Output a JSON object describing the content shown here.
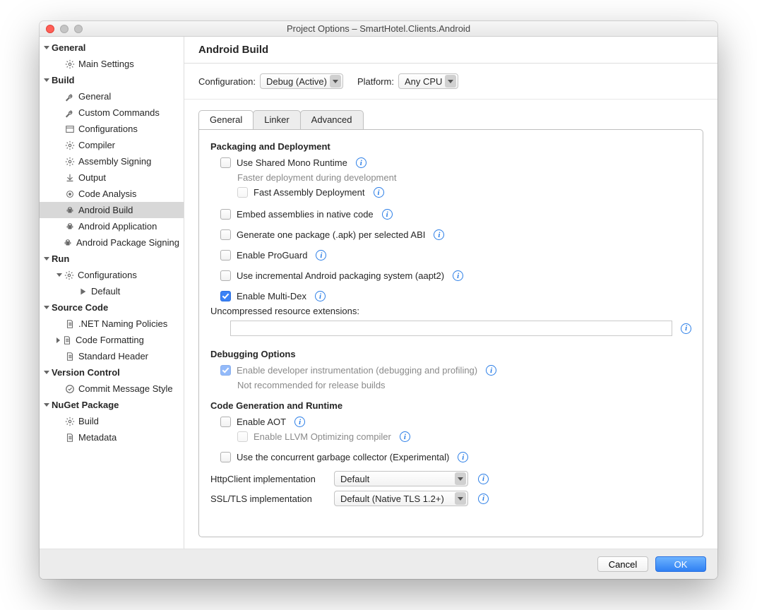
{
  "window_title": "Project Options – SmartHotel.Clients.Android",
  "sidebar": [
    {
      "d": 0,
      "arr": "down",
      "bold": true,
      "label": "General",
      "icon": ""
    },
    {
      "d": 1,
      "arr": "",
      "label": "Main Settings",
      "icon": "gear"
    },
    {
      "d": 0,
      "arr": "down",
      "bold": true,
      "label": "Build",
      "icon": ""
    },
    {
      "d": 1,
      "arr": "",
      "label": "General",
      "icon": "wrench"
    },
    {
      "d": 1,
      "arr": "",
      "label": "Custom Commands",
      "icon": "wrench"
    },
    {
      "d": 1,
      "arr": "",
      "label": "Configurations",
      "icon": "config"
    },
    {
      "d": 1,
      "arr": "",
      "label": "Compiler",
      "icon": "gear"
    },
    {
      "d": 1,
      "arr": "",
      "label": "Assembly Signing",
      "icon": "gear"
    },
    {
      "d": 1,
      "arr": "",
      "label": "Output",
      "icon": "output"
    },
    {
      "d": 1,
      "arr": "",
      "label": "Code Analysis",
      "icon": "target"
    },
    {
      "d": 1,
      "arr": "",
      "label": "Android Build",
      "icon": "android",
      "sel": true
    },
    {
      "d": 1,
      "arr": "",
      "label": "Android Application",
      "icon": "android"
    },
    {
      "d": 1,
      "arr": "",
      "label": "Android Package Signing",
      "icon": "android"
    },
    {
      "d": 0,
      "arr": "down",
      "bold": true,
      "label": "Run",
      "icon": ""
    },
    {
      "d": 1,
      "arr": "down",
      "label": "Configurations",
      "icon": "gear"
    },
    {
      "d": 2,
      "arr": "",
      "label": "Default",
      "icon": "play"
    },
    {
      "d": 0,
      "arr": "down",
      "bold": true,
      "label": "Source Code",
      "icon": ""
    },
    {
      "d": 1,
      "arr": "",
      "label": ".NET Naming Policies",
      "icon": "doc"
    },
    {
      "d": 1,
      "arr": "right",
      "label": "Code Formatting",
      "icon": "doc"
    },
    {
      "d": 1,
      "arr": "",
      "label": "Standard Header",
      "icon": "doc"
    },
    {
      "d": 0,
      "arr": "down",
      "bold": true,
      "label": "Version Control",
      "icon": ""
    },
    {
      "d": 1,
      "arr": "",
      "label": "Commit Message Style",
      "icon": "check"
    },
    {
      "d": 0,
      "arr": "down",
      "bold": true,
      "label": "NuGet Package",
      "icon": ""
    },
    {
      "d": 1,
      "arr": "",
      "label": "Build",
      "icon": "gear"
    },
    {
      "d": 1,
      "arr": "",
      "label": "Metadata",
      "icon": "doc"
    }
  ],
  "page_title": "Android Build",
  "config": {
    "config_label": "Configuration:",
    "config_value": "Debug (Active)",
    "platform_label": "Platform:",
    "platform_value": "Any CPU"
  },
  "tabs": [
    "General",
    "Linker",
    "Advanced"
  ],
  "active_tab": 0,
  "sections": {
    "pkg_title": "Packaging and Deployment",
    "use_shared": "Use Shared Mono Runtime",
    "use_shared_hint": "Faster deployment during development",
    "fast_asm": "Fast Assembly Deployment",
    "embed": "Embed assemblies in native code",
    "per_abi": "Generate one package (.apk) per selected ABI",
    "proguard": "Enable ProGuard",
    "aapt2": "Use incremental Android packaging system (aapt2)",
    "multidex": "Enable Multi-Dex",
    "uncompressed_label": "Uncompressed resource extensions:",
    "uncompressed_value": "",
    "dbg_title": "Debugging Options",
    "devinst": "Enable developer instrumentation (debugging and profiling)",
    "devinst_hint": "Not recommended for release builds",
    "gen_title": "Code Generation and Runtime",
    "aot": "Enable AOT",
    "llvm": "Enable LLVM Optimizing compiler",
    "gc": "Use the concurrent garbage collector (Experimental)",
    "http_label": "HttpClient implementation",
    "http_value": "Default",
    "ssl_label": "SSL/TLS implementation",
    "ssl_value": "Default (Native TLS 1.2+)"
  },
  "buttons": {
    "cancel": "Cancel",
    "ok": "OK"
  }
}
